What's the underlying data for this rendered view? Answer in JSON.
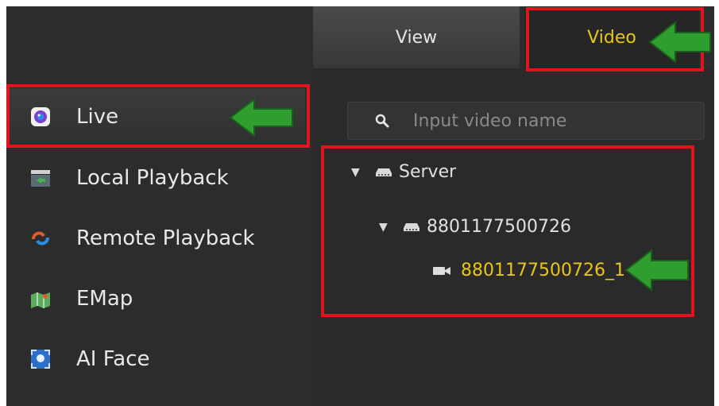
{
  "sidebar": {
    "items": [
      {
        "label": "Live",
        "icon": "live-icon"
      },
      {
        "label": "Local Playback",
        "icon": "local-playback-icon"
      },
      {
        "label": "Remote Playback",
        "icon": "remote-playback-icon"
      },
      {
        "label": "EMap",
        "icon": "emap-icon"
      },
      {
        "label": "AI Face",
        "icon": "ai-face-icon"
      }
    ],
    "active": "Live"
  },
  "tabs": [
    {
      "label": "View"
    },
    {
      "label": "Video",
      "active": true
    }
  ],
  "search": {
    "placeholder": "Input video name"
  },
  "tree": {
    "root": {
      "label": "Server",
      "expanded": true
    },
    "device": {
      "label": "8801177500726",
      "expanded": true
    },
    "channel": {
      "label": "8801177500726_1",
      "selected": true
    }
  },
  "colors": {
    "background": "#2b2b2b",
    "text": "#e8e8e8",
    "accent": "#e6c718",
    "highlight_box": "#e0141e",
    "arrow": "#2e9e2e"
  }
}
